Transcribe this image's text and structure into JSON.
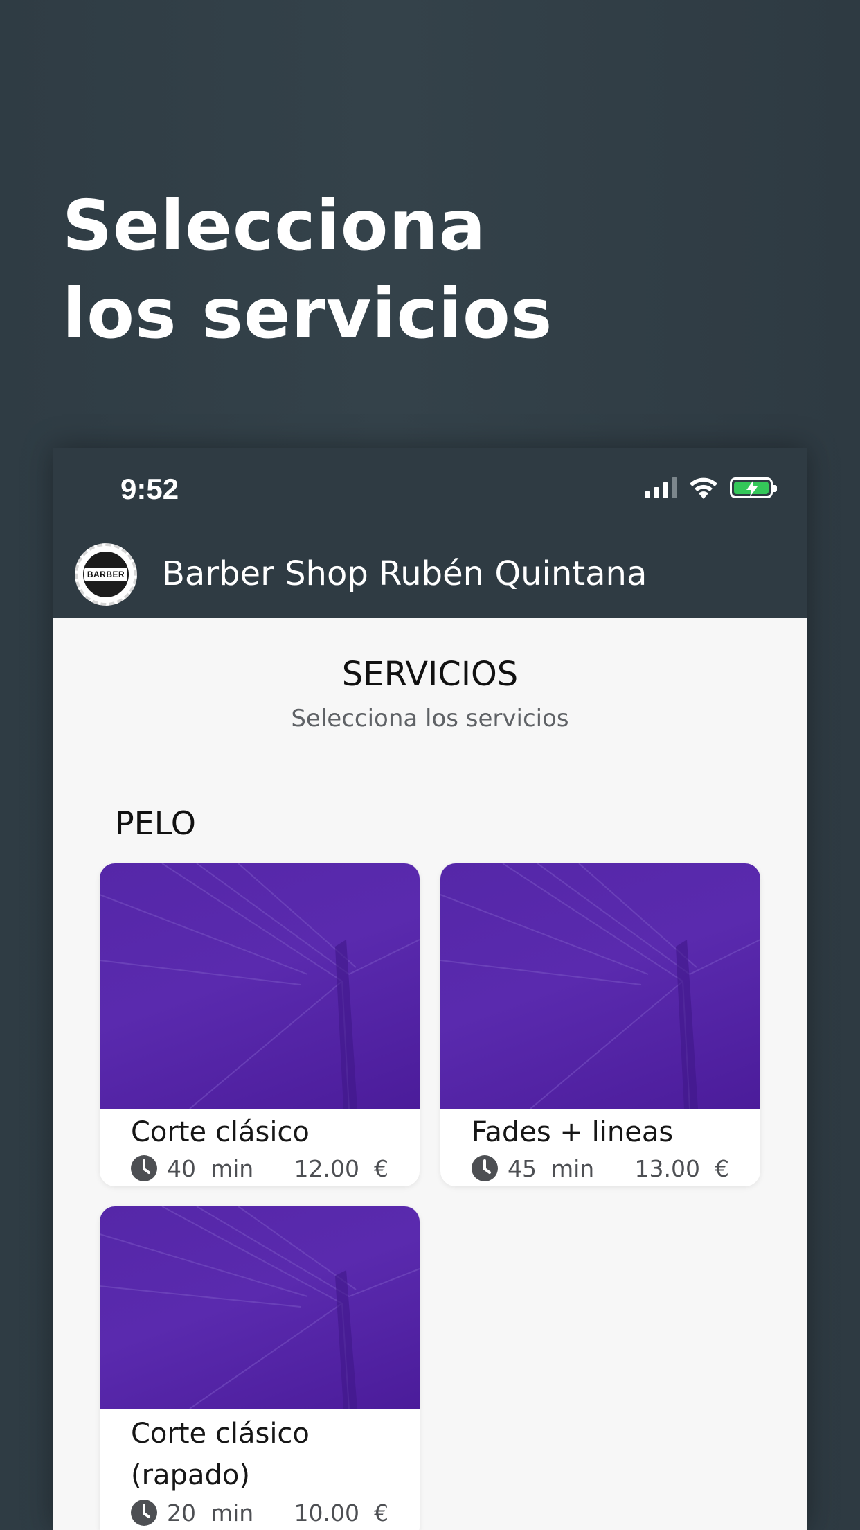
{
  "promo": {
    "line1": "Selecciona",
    "line2": "los servicios"
  },
  "status_bar": {
    "time": "9:52",
    "battery_color": "#34c759"
  },
  "app_header": {
    "shop_name": "Barber Shop Rubén Quintana",
    "logo_text": "BARBER"
  },
  "screen": {
    "title": "SERVICIOS",
    "subtitle": "Selecciona los servicios"
  },
  "category": {
    "label": "PELO"
  },
  "services": [
    {
      "name": "Corte clásico",
      "duration": "40  min",
      "price": "12.00  €"
    },
    {
      "name": "Fades + lineas",
      "duration": "45  min",
      "price": "13.00  €"
    },
    {
      "name": "Corte clásico (rapado)",
      "duration": "20  min",
      "price": "10.00  €"
    }
  ],
  "colors": {
    "background": "#313e46",
    "header": "#2f3b43",
    "card_image": "#5a2aae",
    "card_text": "#161616"
  }
}
